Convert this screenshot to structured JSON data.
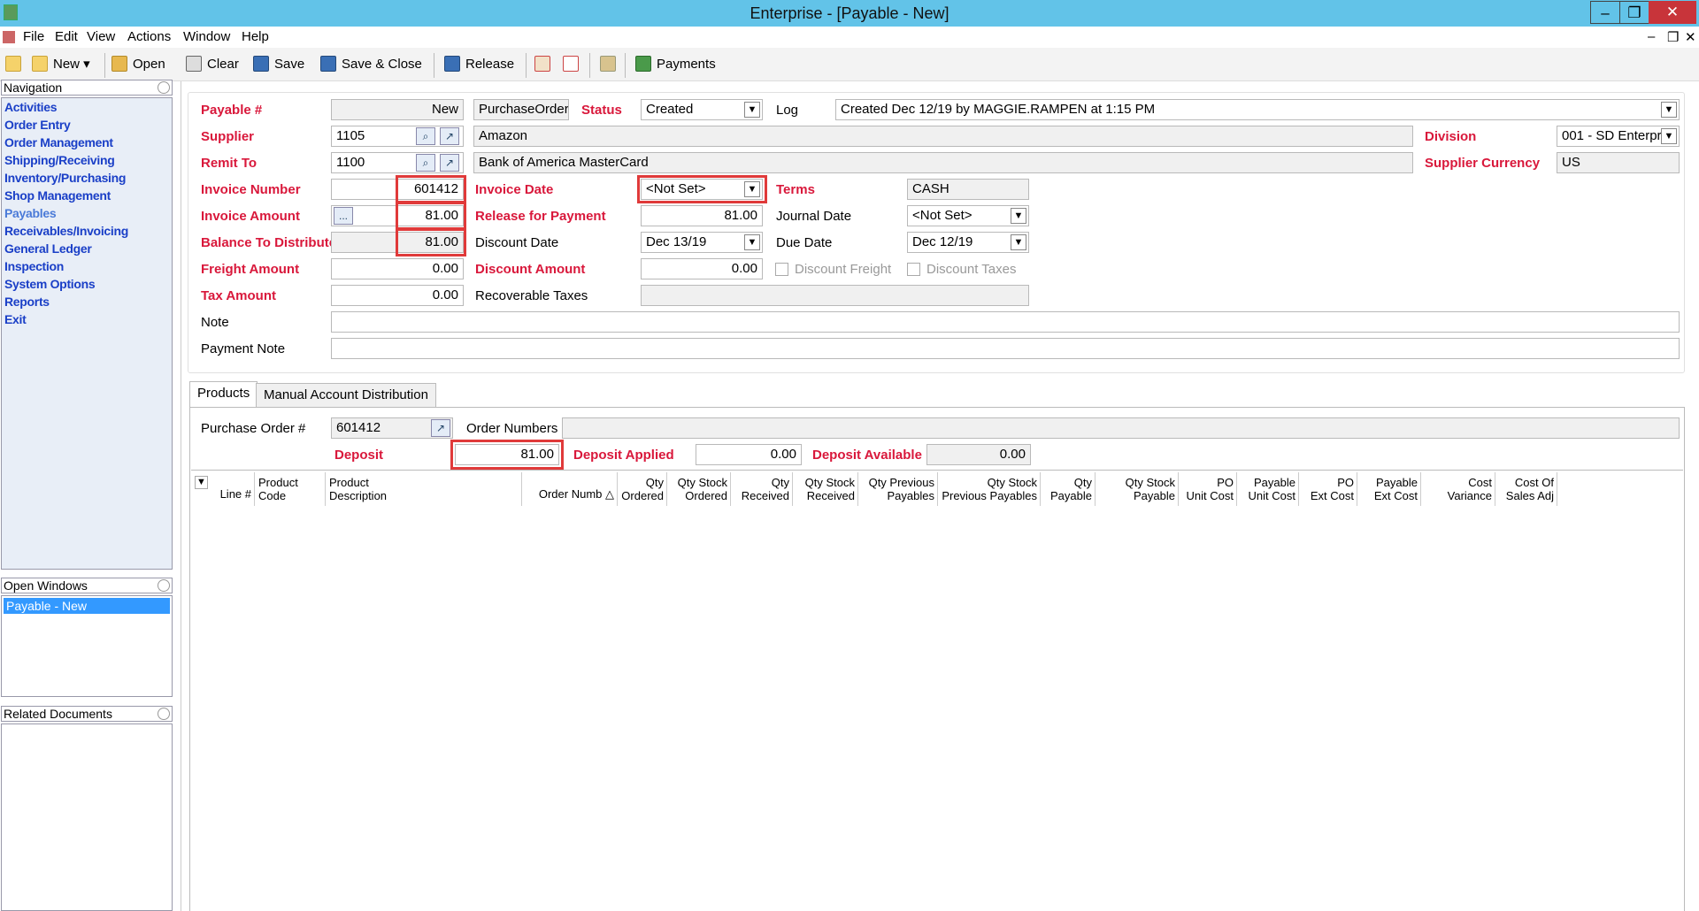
{
  "window": {
    "title": "Enterprise - [Payable - New]",
    "minimize": "–",
    "restore": "❐",
    "close": "✕"
  },
  "menu": [
    "File",
    "Edit",
    "View",
    "Actions",
    "Window",
    "Help"
  ],
  "toolbar": {
    "new": "New",
    "open": "Open",
    "clear": "Clear",
    "save": "Save",
    "save_close": "Save & Close",
    "release": "Release",
    "payments": "Payments"
  },
  "nav": {
    "header": "Navigation",
    "items": [
      "Activities",
      "Order Entry",
      "Order Management",
      "Shipping/Receiving",
      "Inventory/Purchasing",
      "Shop Management",
      "Payables",
      "Receivables/Invoicing",
      "General Ledger",
      "Inspection",
      "System Options",
      "Reports",
      "Exit"
    ],
    "active": "Payables"
  },
  "open_windows": {
    "header": "Open Windows",
    "items": [
      "Payable - New"
    ]
  },
  "related": {
    "header": "Related Documents"
  },
  "form": {
    "payable_label": "Payable #",
    "payable_value": "New",
    "purchase_order_btn": "PurchaseOrder",
    "status_label": "Status",
    "status_value": "Created",
    "log_label": "Log",
    "log_value": "Created Dec 12/19 by MAGGIE.RAMPEN at 1:15 PM",
    "supplier_label": "Supplier",
    "supplier_code": "1105",
    "supplier_name": "Amazon",
    "division_label": "Division",
    "division_value": "001 - SD Enterpr",
    "remit_label": "Remit To",
    "remit_code": "1100",
    "remit_name": "Bank of America MasterCard",
    "supplier_currency_label": "Supplier Currency",
    "supplier_currency_value": "US",
    "invoice_number_label": "Invoice Number",
    "invoice_number_value": "601412",
    "invoice_date_label": "Invoice Date",
    "invoice_date_value": "<Not Set>",
    "terms_label": "Terms",
    "terms_value": "CASH",
    "invoice_amount_label": "Invoice Amount",
    "invoice_amount_btn": "...",
    "invoice_amount_value": "81.00",
    "release_label": "Release for Payment",
    "release_value": "81.00",
    "journal_date_label": "Journal Date",
    "journal_date_value": "<Not Set>",
    "balance_label": "Balance To Distribute",
    "balance_value": "81.00",
    "discount_date_label": "Discount Date",
    "discount_date_value": "Dec 13/19",
    "due_date_label": "Due Date",
    "due_date_value": "Dec 12/19",
    "freight_label": "Freight Amount",
    "freight_value": "0.00",
    "discount_amount_label": "Discount Amount",
    "discount_amount_value": "0.00",
    "discount_freight_label": "Discount Freight",
    "discount_taxes_label": "Discount Taxes",
    "tax_label": "Tax Amount",
    "tax_value": "0.00",
    "recoverable_label": "Recoverable Taxes",
    "note_label": "Note",
    "payment_note_label": "Payment Note"
  },
  "tabs": [
    "Products",
    "Manual Account Distribution"
  ],
  "products": {
    "po_label": "Purchase Order #",
    "po_value": "601412",
    "order_numbers_label": "Order Numbers",
    "deposit_label": "Deposit",
    "deposit_value": "81.00",
    "deposit_applied_label": "Deposit Applied",
    "deposit_applied_value": "0.00",
    "deposit_available_label": "Deposit Available",
    "deposit_available_value": "0.00"
  },
  "columns": [
    {
      "l1": "",
      "l2": "Line #"
    },
    {
      "l1": "Product",
      "l2": "Code"
    },
    {
      "l1": "Product",
      "l2": "Description"
    },
    {
      "l1": "",
      "l2": "Order Numb"
    },
    {
      "l1": "Qty",
      "l2": "Ordered"
    },
    {
      "l1": "Qty Stock",
      "l2": "Ordered"
    },
    {
      "l1": "Qty",
      "l2": "Received"
    },
    {
      "l1": "Qty Stock",
      "l2": "Received"
    },
    {
      "l1": "Qty Previous",
      "l2": "Payables"
    },
    {
      "l1": "Qty Stock",
      "l2": "Previous Payables"
    },
    {
      "l1": "Qty",
      "l2": "Payable"
    },
    {
      "l1": "Qty Stock",
      "l2": "Payable"
    },
    {
      "l1": "PO",
      "l2": "Unit Cost"
    },
    {
      "l1": "Payable",
      "l2": "Unit Cost"
    },
    {
      "l1": "PO",
      "l2": "Ext Cost"
    },
    {
      "l1": "Payable",
      "l2": "Ext Cost"
    },
    {
      "l1": "Cost",
      "l2": "Variance"
    },
    {
      "l1": "Cost Of",
      "l2": "Sales Adj"
    }
  ],
  "sort_icon": "sort-ascending-icon"
}
